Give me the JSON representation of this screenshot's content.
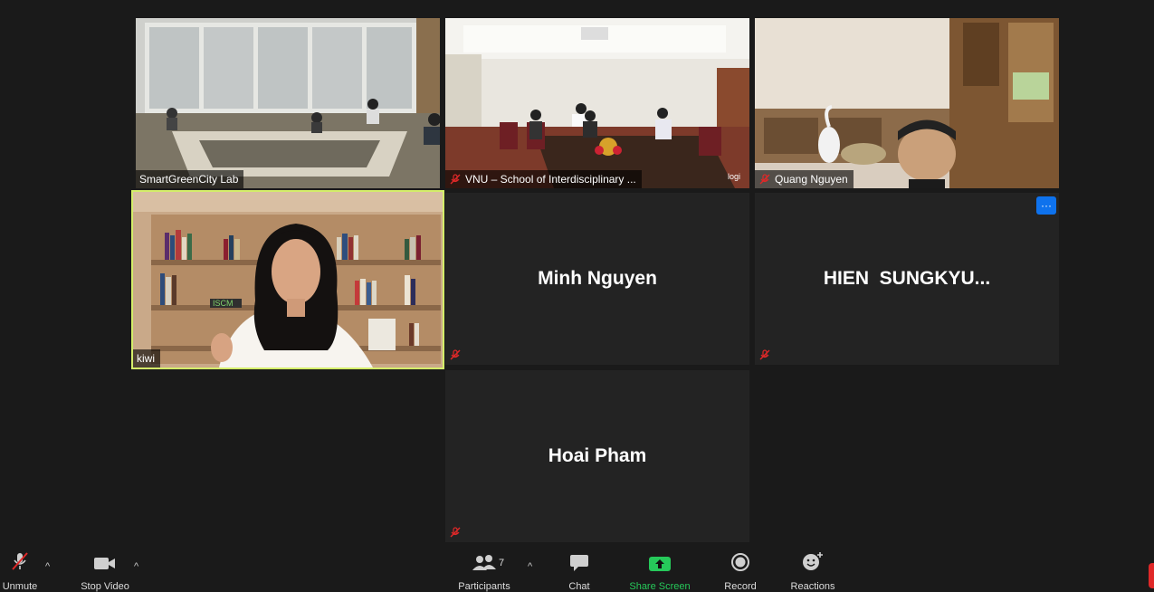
{
  "tiles": {
    "smartgreencity": {
      "name": "SmartGreenCity Lab"
    },
    "vnu": {
      "name": "VNU – School of Interdisciplinary ..."
    },
    "quang": {
      "name": "Quang Nguyen"
    },
    "kiwi": {
      "name": "kiwi"
    },
    "minh": {
      "name": "Minh Nguyen"
    },
    "hien": {
      "name": "HIEN  SUNGKYU..."
    },
    "hoai": {
      "name": "Hoai Pham"
    }
  },
  "vnu_logo_text": "logi",
  "kiwi_poster_text": "ISCM",
  "more_button": "···",
  "toolbar": {
    "unmute": "Unmute",
    "stop_video": "Stop Video",
    "participants": "Participants",
    "participants_count": "7",
    "chat": "Chat",
    "share_screen": "Share Screen",
    "record": "Record",
    "reactions": "Reactions"
  },
  "colors": {
    "active_speaker_border": "#d4ee6a",
    "share_green": "#26c95a",
    "muted_red": "#e02828",
    "more_blue": "#0e72ed"
  }
}
